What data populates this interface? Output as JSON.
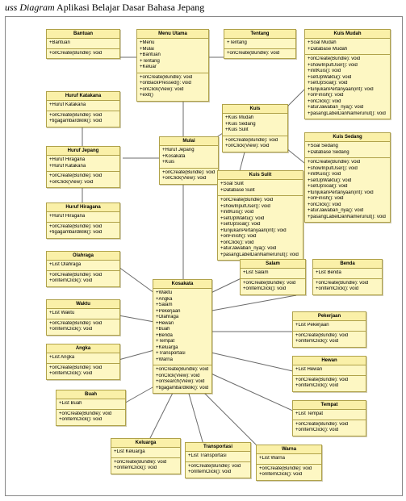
{
  "caption_italic": "uss Diagram",
  "caption_rest": " Aplikasi Belajar Dasar Bahasa Jepang",
  "classes": {
    "bantuan": {
      "title": "Bantuan",
      "attrs": [
        "+Bantuan"
      ],
      "ops": [
        "+onCreate(Bundle): void"
      ]
    },
    "menuUtama": {
      "title": "Menu Utama",
      "attrs": [
        "+Menu",
        "+Mulai",
        "+Bantuan",
        "+Tentang",
        "+Keluar"
      ],
      "ops": [
        "+onCreate(Bundle): void",
        "+onBackPressed(): void",
        "+onClick(View): void",
        "+exit()"
      ]
    },
    "tentang": {
      "title": "Tentang",
      "attrs": [
        "+Tentang"
      ],
      "ops": [
        "+onCreate(Bundle): void"
      ]
    },
    "kuisMudah": {
      "title": "Kuis Mudah",
      "attrs": [
        "+Soal Mudah",
        "+Database Mudah"
      ],
      "ops": [
        "+onCreate(Bundle): void",
        "+showInputUser(): void",
        "+initKuis(): void",
        "+setUpWaktu(): void",
        "+setUpSoal(): void",
        "+tunjukanPertanyaan(int): void",
        "+onFinish(): void",
        "+onClick(): void",
        "+aturJawaban_nya(): void",
        "+pasangLabelDanNamerunut(): void"
      ]
    },
    "hurufKatakana": {
      "title": "Huruf Katakana",
      "attrs": [
        "+Huruf Katakana"
      ],
      "ops": [
        "+onCreate(Bundle): void",
        "+tigagambardiklik(): void"
      ]
    },
    "kuis": {
      "title": "Kuis",
      "attrs": [
        "+Kuis Mudah",
        "+Kuis Sedang",
        "+Kuis Sulit"
      ],
      "ops": [
        "+onCreate(Bundle): void",
        "+onClick(View): void"
      ]
    },
    "hurufJepang": {
      "title": "Huruf Jepang",
      "attrs": [
        "+Huruf Hiragana",
        "+Huruf Katakana"
      ],
      "ops": [
        "+onCreate(Bundle): void",
        "+onClick(View): void"
      ]
    },
    "mulai": {
      "title": "Mulai",
      "attrs": [
        "+Huruf Jepang",
        "+Kosakata",
        "+Kuis"
      ],
      "ops": [
        "+onCreate(Bundle): void",
        "+onClick(View): void"
      ]
    },
    "kuisSedang": {
      "title": "Kuis Sedang",
      "attrs": [
        "+Soal Sedang",
        "+Database Sedang"
      ],
      "ops": [
        "+onCreate(Bundle): void",
        "+showInputUser(): void",
        "+initKuis(): void",
        "+setUpWaktu(): void",
        "+setUpSoal(): void",
        "+tunjukanPertanyaan(int): void",
        "+onFinish(): void",
        "+onClick(): void",
        "+aturJawaban_nya(): void",
        "+pasangLabelDanNamerunut(): void"
      ]
    },
    "kuisSulit": {
      "title": "Kuis Sulit",
      "attrs": [
        "+Soal Sulit",
        "+Database Sulit"
      ],
      "ops": [
        "+onCreate(Bundle): void",
        "+showInputUser(): void",
        "+initKuis(): void",
        "+setUpWaktu(): void",
        "+setUpSoal(): void",
        "+tunjukanPertanyaan(int): void",
        "+onFinish(): void",
        "+onClick(): void",
        "+aturJawaban_nya(): void",
        "+pasangLabelDanNamerunut(): void"
      ]
    },
    "hurufHiragana": {
      "title": "Huruf Hiragana",
      "attrs": [
        "+Huruf Hiragana"
      ],
      "ops": [
        "+onCreate(Bundle): void",
        "+tigagambardiklik(): void"
      ]
    },
    "olahraga": {
      "title": "Olahraga",
      "attrs": [
        "+List Olahraga"
      ],
      "ops": [
        "+onCreate(Bundle): void",
        "+onItemClick(): void"
      ]
    },
    "kosakata": {
      "title": "Kosakata",
      "attrs": [
        "+Waktu",
        "+Angka",
        "+Salam",
        "+Pekerjaan",
        "+Olahraga",
        "+Hewan",
        "+Buah",
        "+Benda",
        "+Tempat",
        "+Keluarga",
        "+Transportasi",
        "+Warna"
      ],
      "ops": [
        "+onCreate(Bundle): void",
        "+onClick(View): void",
        "+onSearch(View): void",
        "+tigagambardiklik(): void"
      ]
    },
    "salam": {
      "title": "Salam",
      "attrs": [
        "+List Salam"
      ],
      "ops": [
        "+onCreate(Bundle): void",
        "+onItemClick(): void"
      ]
    },
    "benda": {
      "title": "Benda",
      "attrs": [
        "+List Benda"
      ],
      "ops": [
        "+onCreate(Bundle): void",
        "+onItemClick(): void"
      ]
    },
    "waktu": {
      "title": "Waktu",
      "attrs": [
        "+List Waktu"
      ],
      "ops": [
        "+onCreate(Bundle): void",
        "+onItemClick(): void"
      ]
    },
    "pekerjaan": {
      "title": "Pekerjaan",
      "attrs": [
        "+List Pekerjaan"
      ],
      "ops": [
        "+onCreate(Bundle): void",
        "+onItemClick(): void"
      ]
    },
    "angka": {
      "title": "Angka",
      "attrs": [
        "+List Angka"
      ],
      "ops": [
        "+onCreate(Bundle): void",
        "+onItemClick(): void"
      ]
    },
    "hewan": {
      "title": "Hewan",
      "attrs": [
        "+List Hewan"
      ],
      "ops": [
        "+onCreate(Bundle): void",
        "+onItemClick(): void"
      ]
    },
    "buah": {
      "title": "Buah",
      "attrs": [
        "+List Buah"
      ],
      "ops": [
        "+onCreate(Bundle): void",
        "+onItemClick(): void"
      ]
    },
    "tempat": {
      "title": "Tempat",
      "attrs": [
        "+List Tempat"
      ],
      "ops": [
        "+onCreate(Bundle): void",
        "+onItemClick(): void"
      ]
    },
    "keluarga": {
      "title": "Keluarga",
      "attrs": [
        "+List Keluarga"
      ],
      "ops": [
        "+onCreate(Bundle): void",
        "+onItemClick(): void"
      ]
    },
    "transportasi": {
      "title": "Transportasi",
      "attrs": [
        "+List Transportasi"
      ],
      "ops": [
        "+onCreate(Bundle): void",
        "+onItemClick(): void"
      ]
    },
    "warna": {
      "title": "Warna",
      "attrs": [
        "+List Warna"
      ],
      "ops": [
        "+onCreate(Bundle): void",
        "+onItemClick(): void"
      ]
    }
  }
}
